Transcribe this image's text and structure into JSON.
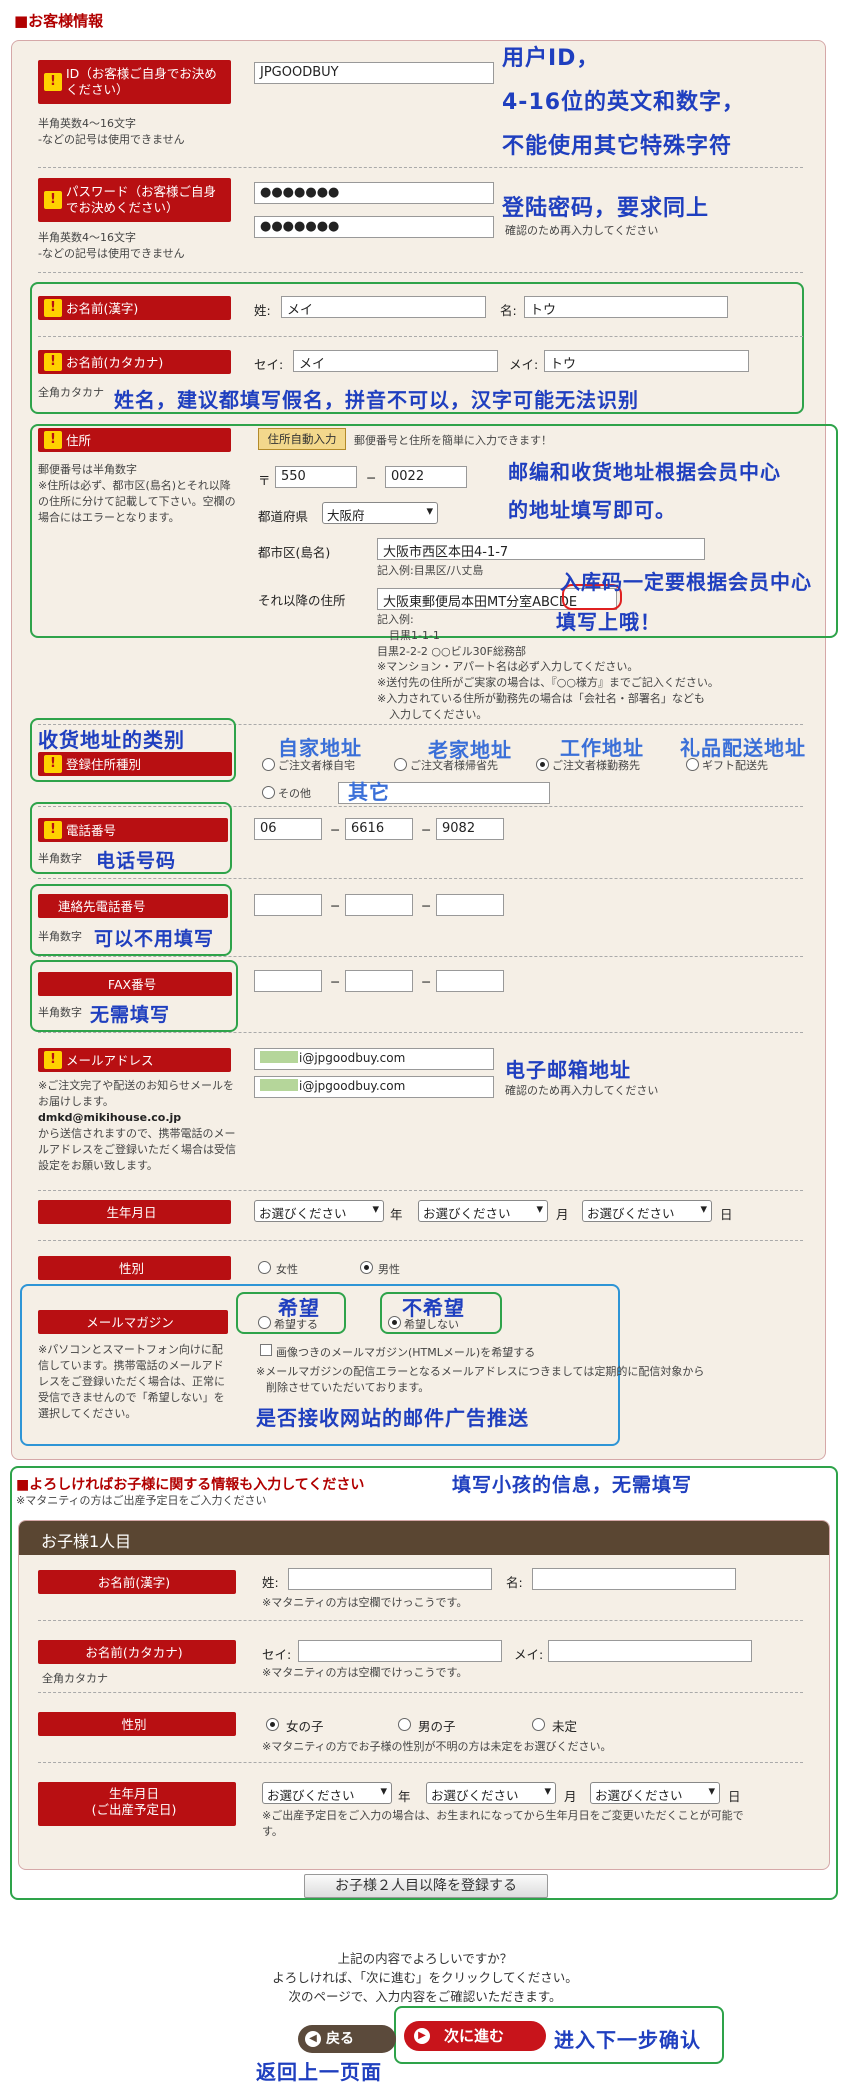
{
  "section_title": "■お客様情報",
  "id_field": {
    "label": "ID（お客様ご自身でお決めください）",
    "note1": "半角英数4〜16文字",
    "note2": "-などの記号は使用できません",
    "value": "JPGOODBUY",
    "annotation_1": "用户ID，",
    "annotation_2": "4-16位的英文和数字，",
    "annotation_3": "不能使用其它特殊字符"
  },
  "password": {
    "label": "パスワード（お客様ご自身でお決めください）",
    "note1": "半角英数4〜16文字",
    "note2": "-などの記号は使用できません",
    "value": "●●●●●●●",
    "confirm": "●●●●●●●",
    "confirm_note": "確認のため再入力してください",
    "annotation": "登陆密码，要求同上"
  },
  "name_kanji": {
    "label": "お名前(漢字)",
    "sei_label": "姓:",
    "sei": "メイ",
    "mei_label": "名:",
    "mei": "トウ"
  },
  "name_kana": {
    "label": "お名前(カタカナ)",
    "note": "全角カタカナ",
    "sei_label": "セイ:",
    "sei": "メイ",
    "mei_label": "メイ:",
    "mei": "トウ",
    "annotation": "姓名，建议都填写假名，拼音不可以，汉字可能无法识别"
  },
  "address": {
    "label": "住所",
    "note1": "郵便番号は半角数字",
    "note2": "※住所は必ず、都市区(島名)とそれ以降の住所に分けて記載して下さい。空欄の場合にはエラーとなります。",
    "auto_button": "住所自動入力",
    "auto_desc": "郵便番号と住所を簡単に入力できます！",
    "zip_mark": "〒",
    "zip1": "550",
    "dash": "−",
    "zip2": "0022",
    "pref_label": "都道府県",
    "pref": "大阪府",
    "city_label": "都市区(島名)",
    "city": "大阪市西区本田4-1-7",
    "city_example": "記入例:目黒区/八丈島",
    "rest_label": "それ以降の住所",
    "rest": "大阪東郵便局本田MT分室ABCDE",
    "rest_example_1": "記入例:",
    "rest_example_2": "目黒1-1-1",
    "rest_example_3": "目黒2-2-2 ○○ビル30F総務部",
    "rest_note_1": "※マンション・アパート名は必ず入力してください。",
    "rest_note_2": "※送付先の住所がご実家の場合は、『○○様方』までご記入ください。",
    "rest_note_3": "※入力されている住所が勤務先の場合は「会社名・部署名」なども",
    "rest_note_4": "入力してください。",
    "annotation_1": "邮编和收货地址根据会员中心",
    "annotation_2": "的地址填写即可。",
    "annotation_3": "入库码一定要根据会员中心",
    "annotation_4": "填写上哦！"
  },
  "addr_type": {
    "label": "登録住所種別",
    "annotation": "收货地址的类别",
    "opt1": "ご注文者様自宅",
    "opt2": "ご注文者様帰省先",
    "opt3": "ご注文者様勤務先",
    "opt4": "ギフト配送先",
    "opt5": "その他",
    "ann1": "自家地址",
    "ann2": "老家地址",
    "ann3": "工作地址",
    "ann4": "礼品配送地址",
    "ann5": "其它"
  },
  "phone": {
    "label": "電話番号",
    "note": "半角数字",
    "p1": "06",
    "p2": "6616",
    "p3": "9082",
    "annotation": "电话号码"
  },
  "contact_phone": {
    "label": "連絡先電話番号",
    "note": "半角数字",
    "annotation": "可以不用填写"
  },
  "fax": {
    "label": "FAX番号",
    "note": "半角数字",
    "annotation": "无需填写"
  },
  "email": {
    "label": "メールアドレス",
    "note1": "※ご注文完了や配送のお知らせメールをお届けします。",
    "note2": "dmkd@mikihouse.co.jp",
    "note3": "から送信されますので、携帯電話のメールアドレスをご登録いただく場合は受信設定をお願い致します。",
    "value": "i@jpgoodbuy.com",
    "confirm": "i@jpgoodbuy.com",
    "confirm_note": "確認のため再入力してください",
    "annotation": "电子邮箱地址"
  },
  "birthday": {
    "label": "生年月日",
    "placeholder": "お選びください",
    "year": "年",
    "month": "月",
    "day": "日"
  },
  "gender": {
    "label": "性別",
    "female": "女性",
    "male": "男性"
  },
  "magazine": {
    "label": "メールマガジン",
    "note": "※パソコンとスマートフォン向けに配信しています。携帯電話のメールアドレスをご登録いただく場合は、正常に受信できませんので「希望しない」を選択してください。",
    "opt_yes": "希望する",
    "opt_no": "希望しない",
    "ann_yes": "希望",
    "ann_no": "不希望",
    "html_opt": "画像つきのメールマガジン(HTMLメール)を希望する",
    "notice_1": "※メールマガジンの配信エラーとなるメールアドレスにつきましては定期的に配信対象から",
    "notice_2": "削除させていただいております。",
    "annotation": "是否接收网站的邮件广告推送"
  },
  "children": {
    "title": "■よろしければお子様に関する情報も入力してください",
    "subtitle": "※マタニティの方はご出産予定日をご入力ください",
    "annotation": "填写小孩的信息，无需填写",
    "child_header": "お子様1人目",
    "kanji_label": "お名前(漢字)",
    "sei_label": "姓:",
    "mei_label": "名:",
    "kanji_note": "※マタニティの方は空欄でけっこうです。",
    "kana_label": "お名前(カタカナ)",
    "kana_note": "全角カタカナ",
    "kana_sei_label": "セイ:",
    "kana_mei_label": "メイ:",
    "kana_note2": "※マタニティの方は空欄でけっこうです。",
    "gender_label": "性別",
    "g1": "女の子",
    "g2": "男の子",
    "g3": "未定",
    "gender_note": "※マタニティの方でお子様の性別が不明の方は未定をお選びください。",
    "birth_label_1": "生年月日",
    "birth_label_2": "(ご出産予定日)",
    "birth_placeholder": "お選びください",
    "year": "年",
    "month": "月",
    "day": "日",
    "birth_note_1": "※ご出産予定日をご入力の場合は、お生まれになってから生年月日をご変更いただくことが可能で",
    "birth_note_2": "す。",
    "more_button": "お子様２人目以降を登録する"
  },
  "confirm": {
    "line1": "上記の内容でよろしいですか？",
    "line2": "よろしければ、「次に進む」をクリックしてください。",
    "line3": "次のページで、入力内容をご確認いただきます。",
    "back_button": "戻る",
    "next_button": "次に進む",
    "ann_back": "返回上一页面",
    "ann_next": "进入下一步确认"
  },
  "colors": {
    "label_red": "#b80f12",
    "annotation_blue": "#1f3fbf",
    "box_green": "#2ea34a",
    "panel_bg": "#f5efe6"
  }
}
